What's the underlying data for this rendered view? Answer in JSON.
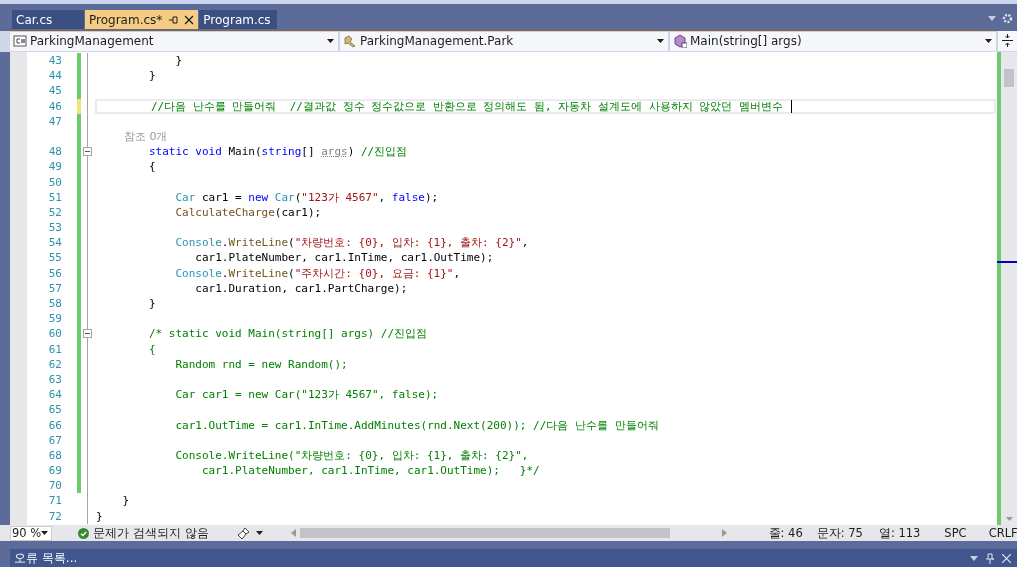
{
  "tabs": [
    {
      "label": "Car.cs",
      "selected": false
    },
    {
      "label": "Program.cs*",
      "selected": true
    },
    {
      "label": "Program.cs",
      "selected": false
    }
  ],
  "navigation_bar": {
    "project": "ParkingManagement",
    "type": "ParkingManagement.Park",
    "member": "Main(string[] args)"
  },
  "editor": {
    "lines": [
      {
        "number": "43",
        "changed": true,
        "unsaved": false,
        "current": false,
        "collapsible": false,
        "segments": [
          {
            "kind": "plain",
            "text": "            }"
          }
        ]
      },
      {
        "number": "44",
        "changed": true,
        "unsaved": false,
        "current": false,
        "collapsible": false,
        "segments": [
          {
            "kind": "plain",
            "text": "        }"
          }
        ]
      },
      {
        "number": "45",
        "changed": true,
        "unsaved": false,
        "current": false,
        "collapsible": false
      },
      {
        "number": "46",
        "changed": true,
        "unsaved": true,
        "current": true,
        "collapsible": false,
        "segments": [
          {
            "kind": "comment",
            "text": "        //다음 난수를 만들어줘  //결과값 정수 정수값으로 반환으로 정의해도 됨, 자동차 설계도에 사용하지 않았던 멤버변수 "
          }
        ]
      },
      {
        "number": "47",
        "changed": true,
        "unsaved": false,
        "current": false,
        "collapsible": false
      },
      {
        "number": "48",
        "changed": true,
        "unsaved": false,
        "current": false,
        "collapsible": true,
        "codelens": "참조 0개",
        "segments": [
          {
            "kind": "keyword",
            "text": "        static"
          },
          {
            "kind": "keyword",
            "text": " void"
          },
          {
            "kind": "plain",
            "text": " Main("
          },
          {
            "kind": "keyword",
            "text": "string"
          },
          {
            "kind": "plain",
            "text": "[] "
          },
          {
            "kind": "unused",
            "text": "args"
          },
          {
            "kind": "plain",
            "text": ") "
          },
          {
            "kind": "comment",
            "text": "//진입점"
          }
        ]
      },
      {
        "number": "49",
        "changed": true,
        "unsaved": false,
        "current": false,
        "collapsible": false,
        "segments": [
          {
            "kind": "plain",
            "text": "        {"
          }
        ]
      },
      {
        "number": "50",
        "changed": true,
        "unsaved": false,
        "current": false,
        "collapsible": false
      },
      {
        "number": "51",
        "changed": true,
        "unsaved": false,
        "current": false,
        "collapsible": false,
        "segments": [
          {
            "kind": "type",
            "text": "            Car"
          },
          {
            "kind": "plain",
            "text": " car1 = "
          },
          {
            "kind": "keyword",
            "text": "new"
          },
          {
            "kind": "type",
            "text": " Car"
          },
          {
            "kind": "plain",
            "text": "("
          },
          {
            "kind": "string",
            "text": "\"123가 4567\""
          },
          {
            "kind": "plain",
            "text": ", "
          },
          {
            "kind": "keyword",
            "text": "false"
          },
          {
            "kind": "plain",
            "text": ");"
          }
        ]
      },
      {
        "number": "52",
        "changed": true,
        "unsaved": false,
        "current": false,
        "collapsible": false,
        "segments": [
          {
            "kind": "method",
            "text": "            CalculateCharge"
          },
          {
            "kind": "plain",
            "text": "(car1);"
          }
        ]
      },
      {
        "number": "53",
        "changed": true,
        "unsaved": false,
        "current": false,
        "collapsible": false
      },
      {
        "number": "54",
        "changed": true,
        "unsaved": false,
        "current": false,
        "collapsible": false,
        "segments": [
          {
            "kind": "type",
            "text": "            Console"
          },
          {
            "kind": "plain",
            "text": "."
          },
          {
            "kind": "method",
            "text": "WriteLine"
          },
          {
            "kind": "plain",
            "text": "("
          },
          {
            "kind": "string",
            "text": "\"차량번호: {0}, 입차: {1}, 출차: {2}\""
          },
          {
            "kind": "plain",
            "text": ","
          }
        ]
      },
      {
        "number": "55",
        "changed": true,
        "unsaved": false,
        "current": false,
        "collapsible": false,
        "segments": [
          {
            "kind": "plain",
            "text": "               car1.PlateNumber, car1.InTime, car1.OutTime);"
          }
        ]
      },
      {
        "number": "56",
        "changed": true,
        "unsaved": false,
        "current": false,
        "collapsible": false,
        "segments": [
          {
            "kind": "type",
            "text": "            Console"
          },
          {
            "kind": "plain",
            "text": "."
          },
          {
            "kind": "method",
            "text": "WriteLine"
          },
          {
            "kind": "plain",
            "text": "("
          },
          {
            "kind": "string",
            "text": "\"주차시간: {0}, 요금: {1}\""
          },
          {
            "kind": "plain",
            "text": ","
          }
        ]
      },
      {
        "number": "57",
        "changed": true,
        "unsaved": false,
        "current": false,
        "collapsible": false,
        "segments": [
          {
            "kind": "plain",
            "text": "               car1.Duration, car1.PartCharge);"
          }
        ]
      },
      {
        "number": "58",
        "changed": true,
        "unsaved": false,
        "current": false,
        "collapsible": false,
        "segments": [
          {
            "kind": "plain",
            "text": "        }"
          }
        ]
      },
      {
        "number": "59",
        "changed": true,
        "unsaved": false,
        "current": false,
        "collapsible": false
      },
      {
        "number": "60",
        "changed": true,
        "unsaved": false,
        "current": false,
        "collapsible": true,
        "segments": [
          {
            "kind": "comment",
            "text": "        /* static void Main(string[] args) //진입점"
          }
        ]
      },
      {
        "number": "61",
        "changed": true,
        "unsaved": false,
        "current": false,
        "collapsible": false,
        "segments": [
          {
            "kind": "comment",
            "text": "        {"
          }
        ]
      },
      {
        "number": "62",
        "changed": true,
        "unsaved": false,
        "current": false,
        "collapsible": false,
        "segments": [
          {
            "kind": "comment",
            "text": "            Random rnd = new Random();"
          }
        ]
      },
      {
        "number": "63",
        "changed": true,
        "unsaved": false,
        "current": false,
        "collapsible": false
      },
      {
        "number": "64",
        "changed": true,
        "unsaved": false,
        "current": false,
        "collapsible": false,
        "segments": [
          {
            "kind": "comment",
            "text": "            Car car1 = new Car(\"123가 4567\", false);"
          }
        ]
      },
      {
        "number": "65",
        "changed": true,
        "unsaved": false,
        "current": false,
        "collapsible": false
      },
      {
        "number": "66",
        "changed": true,
        "unsaved": false,
        "current": false,
        "collapsible": false,
        "segments": [
          {
            "kind": "comment",
            "text": "            car1.OutTime = car1.InTime.AddMinutes(rnd.Next(200)); //다음 난수를 만들어줘"
          }
        ]
      },
      {
        "number": "67",
        "changed": true,
        "unsaved": false,
        "current": false,
        "collapsible": false
      },
      {
        "number": "68",
        "changed": true,
        "unsaved": false,
        "current": false,
        "collapsible": false,
        "segments": [
          {
            "kind": "comment",
            "text": "            Console.WriteLine(\"차량번호: {0}, 입차: {1}, 출차: {2}\","
          }
        ]
      },
      {
        "number": "69",
        "changed": true,
        "unsaved": false,
        "current": false,
        "collapsible": false,
        "segments": [
          {
            "kind": "comment",
            "text": "                car1.PlateNumber, car1.InTime, car1.OutTime);   }*/"
          }
        ]
      },
      {
        "number": "70",
        "changed": true,
        "unsaved": false,
        "current": false,
        "collapsible": false
      },
      {
        "number": "71",
        "changed": false,
        "unsaved": false,
        "current": false,
        "collapsible": false,
        "segments": [
          {
            "kind": "plain",
            "text": "    }"
          }
        ]
      },
      {
        "number": "72",
        "changed": false,
        "unsaved": false,
        "current": false,
        "collapsible": false,
        "segments": [
          {
            "kind": "plain",
            "text": "}"
          }
        ]
      }
    ]
  },
  "status_bar": {
    "zoom": "90 %",
    "issues": "문제가 검색되지 않음",
    "line": "줄: 46",
    "character": "문자: 75",
    "column": "열: 113",
    "whitespace": "SPC",
    "line_ending": "CRLF"
  },
  "bottom_panel": {
    "title": "오류 목록..."
  }
}
